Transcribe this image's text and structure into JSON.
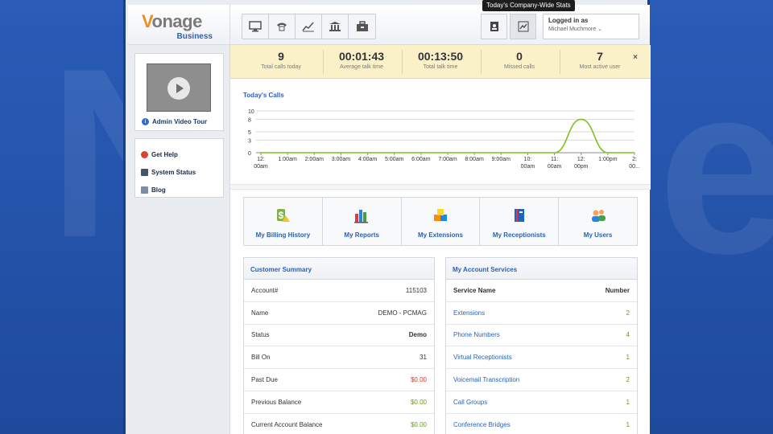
{
  "brand": {
    "logo_main": "onage",
    "logo_v": "V",
    "logo_sub": "Business"
  },
  "tooltip": "Today's Company-Wide Stats",
  "login": {
    "label": "Logged in as",
    "user": "Michael Muchmore ⌄"
  },
  "sidebar": {
    "tour_label": "Admin Video Tour",
    "links": [
      {
        "label": "Get Help",
        "color": "#d9432e"
      },
      {
        "label": "System Status",
        "color": "#445566"
      },
      {
        "label": "Blog",
        "color": "#7a8ea6"
      }
    ]
  },
  "stats": [
    {
      "value": "9",
      "label": "Total calls today"
    },
    {
      "value": "00:01:43",
      "label": "Average talk time"
    },
    {
      "value": "00:13:50",
      "label": "Total talk time"
    },
    {
      "value": "0",
      "label": "Missed calls"
    },
    {
      "value": "7",
      "label": "Most active user"
    }
  ],
  "stats_close": "×",
  "chart_title": "Today's Calls",
  "chart_data": {
    "type": "line",
    "y_ticks": [
      "10",
      "8",
      "5",
      "3",
      "0"
    ],
    "ylim": [
      0,
      10
    ],
    "x_labels": [
      [
        "12:",
        "00am"
      ],
      [
        "1:00am"
      ],
      [
        "2:00am"
      ],
      [
        "3:00am"
      ],
      [
        "4:00am"
      ],
      [
        "5:00am"
      ],
      [
        "6:00am"
      ],
      [
        "7:00am"
      ],
      [
        "8:00am"
      ],
      [
        "9:00am"
      ],
      [
        "10:",
        "00am"
      ],
      [
        "11:",
        "00am"
      ],
      [
        "12:",
        "00pm"
      ],
      [
        "1:00pm"
      ],
      [
        "2:",
        "00..."
      ]
    ],
    "values": [
      0,
      0,
      0,
      0,
      0,
      0,
      0,
      0,
      0,
      0,
      0,
      0,
      8,
      0,
      0
    ],
    "line_color": "#7cc421"
  },
  "quick_links": [
    {
      "label": "My Billing History",
      "icon": "dollar-icon"
    },
    {
      "label": "My Reports",
      "icon": "bar-chart-icon"
    },
    {
      "label": "My Extensions",
      "icon": "cubes-icon"
    },
    {
      "label": "My Receptionists",
      "icon": "book-icon"
    },
    {
      "label": "My Users",
      "icon": "users-icon"
    }
  ],
  "customer_summary": {
    "title": "Customer Summary",
    "rows": [
      {
        "label": "Account#",
        "value": "115103",
        "style": ""
      },
      {
        "label": "Name",
        "value": "DEMO - PCMAG",
        "style": ""
      },
      {
        "label": "Status",
        "value": "Demo",
        "style": "bold"
      },
      {
        "label": "Bill On",
        "value": "31",
        "style": ""
      },
      {
        "label": "Past Due",
        "value": "$0.00",
        "style": "red"
      },
      {
        "label": "Previous Balance",
        "value": "$0.00",
        "style": "green"
      },
      {
        "label": "Current Account Balance",
        "value": "$0.00",
        "style": "green"
      }
    ]
  },
  "account_services": {
    "title": "My Account Services",
    "header": {
      "name": "Service Name",
      "number": "Number"
    },
    "rows": [
      {
        "name": "Extensions",
        "number": "2"
      },
      {
        "name": "Phone Numbers",
        "number": "4"
      },
      {
        "name": "Virtual Receptionists",
        "number": "1"
      },
      {
        "name": "Voicemail Transcription",
        "number": "2"
      },
      {
        "name": "Call Groups",
        "number": "1"
      },
      {
        "name": "Conference Bridges",
        "number": "1"
      }
    ]
  }
}
